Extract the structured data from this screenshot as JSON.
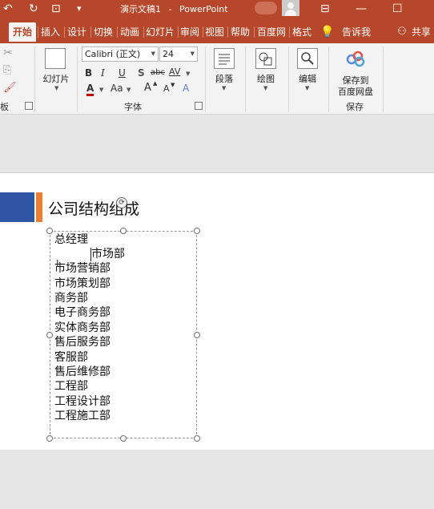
{
  "titlebar": {
    "doc_name": "演示文稿1",
    "separator": "-",
    "app_name": "PowerPoint",
    "undo_glyph": "↶",
    "redo_glyph": "↻",
    "present_glyph": "⊡",
    "customize_glyph": "▾",
    "ribbon_display_glyph": "⊟",
    "minimize_glyph": "—",
    "maximize_glyph": "☐"
  },
  "tabs": [
    {
      "label": "开始",
      "active": true
    },
    {
      "label": "插入"
    },
    {
      "label": "设计"
    },
    {
      "label": "切换"
    },
    {
      "label": "动画"
    },
    {
      "label": "幻灯片"
    },
    {
      "label": "审阅"
    },
    {
      "label": "视图"
    },
    {
      "label": "帮助"
    },
    {
      "label": "百度网"
    },
    {
      "label": "格式"
    },
    {
      "label": "告诉我"
    },
    {
      "label": "共享"
    }
  ],
  "ribbon": {
    "clipboard_label": "板",
    "new_slide_label": "幻灯片",
    "font": {
      "family": "Calibri (正文)",
      "size": "24",
      "bold": "B",
      "italic": "I",
      "underline": "U",
      "shadow": "S",
      "strike": "abc",
      "spacing": "AV",
      "font_color": "A",
      "change_case": "Aa",
      "grow": "A",
      "shrink": "A",
      "clear": "A",
      "group_label": "字体"
    },
    "paragraph_label": "段落",
    "drawing_label": "绘图",
    "editing_label": "编辑",
    "baidu_save_line1": "保存到",
    "baidu_save_line2": "百度网盘",
    "save_group_label": "保存"
  },
  "slide": {
    "title": "公司结构组成",
    "lines": [
      "总经理",
      "市场部",
      "市场营销部",
      "市场策划部",
      "商务部",
      "电子商务部",
      "实体商务部",
      "售后服务部",
      "客服部",
      "售后维修部",
      "工程部",
      "工程设计部",
      "工程施工部"
    ]
  }
}
